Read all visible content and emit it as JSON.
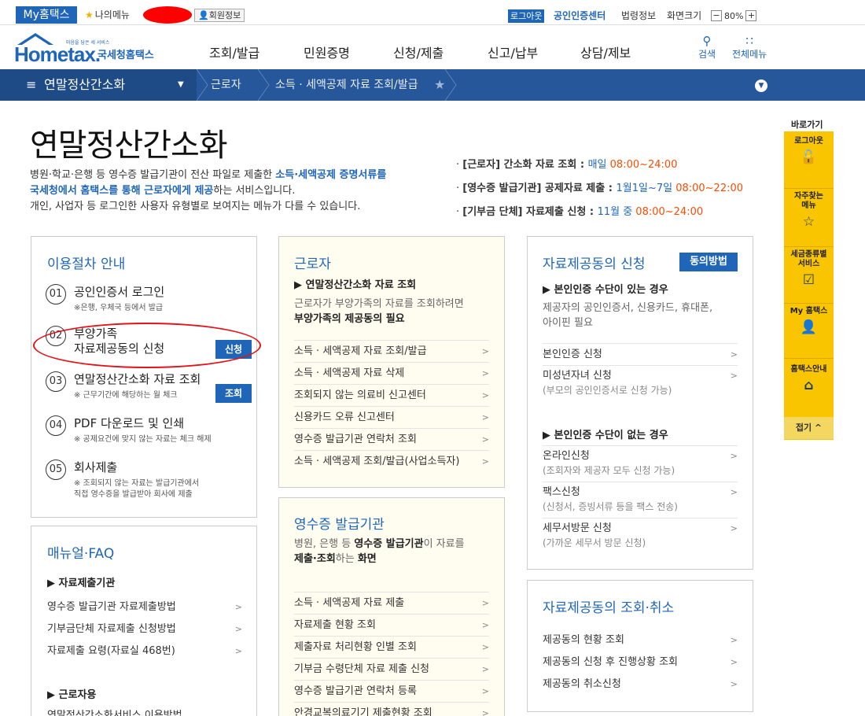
{
  "topbar": {
    "my_hometax": "My홈택스",
    "my_menu": "나의메뉴",
    "member_info": "회원정보",
    "logout": "로그아웃",
    "cert_center": "공인인증센터",
    "law_info": "법령정보",
    "screen_size": "화면크기",
    "zoom_minus": "−",
    "zoom_value": "80%",
    "zoom_plus": "+"
  },
  "logo": {
    "tagline": "마음을 담은 세 서비스",
    "brand": "Hometax.",
    "sub": "국세청홈택스"
  },
  "main_nav": [
    "조회/발급",
    "민원증명",
    "신청/제출",
    "신고/납부",
    "상담/제보"
  ],
  "nav_right": {
    "search": "검색",
    "all_menu": "전체메뉴"
  },
  "breadcrumb": {
    "menu": "연말정산간소화",
    "items": [
      "근로자",
      "소득 · 세액공제 자료 조회/발급"
    ]
  },
  "page": {
    "title": "연말정산간소화",
    "desc_line1_a": "병원·학교·은행 등 영수증 발급기관이 전산 파일로 제출한 ",
    "desc_line1_b": "소득·세액공제 증명서류를",
    "desc_line2_a": "국세청에서 홈택스를 통해 근로자에게 제공",
    "desc_line2_b": "하는 서비스입니다.",
    "desc_line3": "개인, 사업자 등 로그인한 사용자 유형별로 보여지는 메뉴가 다를 수 있습니다."
  },
  "schedule": [
    {
      "bullet": "·",
      "label": "[근로자] 간소화 자료 조회 : ",
      "period": "매일 ",
      "time": "08:00~24:00"
    },
    {
      "bullet": "·",
      "label": "[영수증 발급기관] 공제자료 제출 : ",
      "period": "1월1일~7일 ",
      "time": "08:00~22:00"
    },
    {
      "bullet": "·",
      "label": "[기부금 단체] 자료제출 신청 : ",
      "period": "11월 중 ",
      "time": "08:00~24:00"
    }
  ],
  "procedure": {
    "title": "이용절차 안내",
    "steps": [
      {
        "num": "01",
        "label": "공인인증서 로그인",
        "note": "※은행, 우체국 등에서 발급"
      },
      {
        "num": "02",
        "label": "부양가족",
        "label2": "자료제공동의 신청",
        "badge": "신청"
      },
      {
        "num": "03",
        "label": "연말정산간소화 자료 조회",
        "note": "※ 근무기간에 해당하는 월 체크",
        "badge": "조회"
      },
      {
        "num": "04",
        "label": "PDF 다운로드 및 인쇄",
        "note": "※ 공제요건에 맞지 않는 자료는 체크 해제"
      },
      {
        "num": "05",
        "label": "회사제출",
        "note": "※ 조회되지 않는 자료는 발급기관에서",
        "note2": "직접 영수증을 발급받아 회사에 제출"
      }
    ]
  },
  "manual": {
    "title": "매뉴얼·FAQ",
    "section1": "▶ 자료제출기관",
    "items1": [
      "영수증 발급기관 자료제출방법",
      "기부금단체 자료제출 신청방법",
      "자료제출 요령(자료실 468번)"
    ],
    "section2": "▶ 근로자용",
    "items2": [
      "연말정산간소화서비스 이용방법"
    ]
  },
  "worker": {
    "title": "근로자",
    "sub": "▶ 연말정산간소화 자료 조회",
    "desc1": "근로자가 부양가족의 자료를 조회하려면",
    "desc2": "부양가족의 제공동의 필요",
    "links": [
      "소득 · 세액공제 자료 조회/발급",
      "소득 · 세액공제 자료 삭제",
      "조회되지 않는 의료비 신고센터",
      "신용카드 오류 신고센터",
      "영수증 발급기관 연락처 조회",
      "소득 · 세액공제 조회/발급(사업소득자)"
    ]
  },
  "issuer": {
    "title": "영수증 발급기관",
    "desc1_a": "병원, 은행 등 ",
    "desc1_b": "영수증 발급기관",
    "desc1_c": "이 자료를",
    "desc2_a": "제출·조회",
    "desc2_b": "하는 ",
    "desc2_c": "화면",
    "links": [
      "소득 · 세액공제 자료 제출",
      "자료제출 현황 조회",
      "제출자료 처리현황 인별 조회",
      "기부금 수령단체 자료 제출 신청",
      "영수증 발급기관 연락처 등록",
      "안경교복의료기기 제출현황 조회"
    ]
  },
  "consent": {
    "title": "자료제공동의 신청",
    "badge": "동의방법",
    "sub1": "▶ 본인인증 수단이 있는 경우",
    "desc1": "제공자의 공인인증서, 신용카드, 휴대폰,",
    "desc2": "아이핀 필요",
    "links1": [
      {
        "label": "본인인증 신청",
        "sub": ""
      },
      {
        "label": "미성년자녀 신청",
        "sub": "(부모의 공인인증서로 신청 가능)"
      }
    ],
    "sub2": "▶ 본인인증 수단이 없는 경우",
    "links2": [
      {
        "label": "온라인신청",
        "sub": "(조회자와 제공자 모두 신청 가능)"
      },
      {
        "label": "팩스신청",
        "sub": "(신청서, 증빙서류 등을 팩스 전송)"
      },
      {
        "label": "세무서방문 신청",
        "sub": "(가까운 세무서 방문 신청)"
      }
    ]
  },
  "cancel": {
    "title": "자료제공동의 조회·취소",
    "links": [
      "제공동의 현황 조회",
      "제공동의 신청 후 진행상황 조회",
      "제공동의 취소신청"
    ]
  },
  "quick": {
    "title": "바로가기",
    "items": [
      {
        "label": "로그아웃",
        "icon": "unlock-icon"
      },
      {
        "label": "자주찾는",
        "label2": "메뉴",
        "icon": "star-icon"
      },
      {
        "label": "세금종류별",
        "label2": "서비스",
        "icon": "check-icon"
      },
      {
        "label": "My 홈택스",
        "icon": "user-icon"
      },
      {
        "label": "홈택스안내",
        "icon": "home-icon"
      }
    ],
    "fold": "접기 ^"
  }
}
